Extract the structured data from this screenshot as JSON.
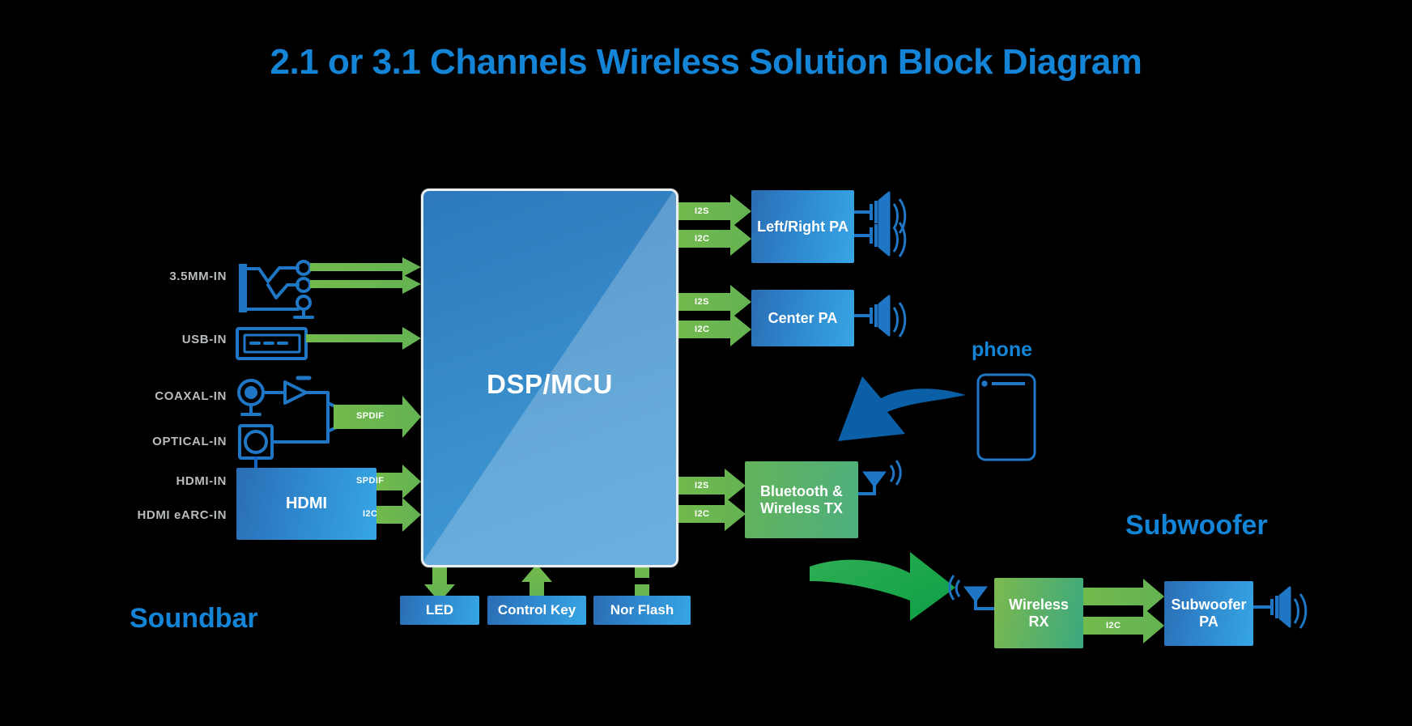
{
  "title": "2.1 or 3.1 Channels Wireless Solution Block Diagram",
  "headings": {
    "soundbar": "Soundbar",
    "subwoofer": "Subwoofer",
    "phone": "phone"
  },
  "inputs": [
    {
      "label": "3.5MM-IN",
      "icon": "jack-3p5mm-icon"
    },
    {
      "label": "USB-IN",
      "icon": "usb-port-icon"
    },
    {
      "label": "COAXAL-IN",
      "icon": "coaxial-jack-icon"
    },
    {
      "label": "OPTICAL-IN",
      "icon": "optical-toslink-icon"
    },
    {
      "label": "HDMI-IN",
      "icon": "hdmi-block-icon"
    },
    {
      "label": "HDMI eARC-IN",
      "icon": "hdmi-block-icon"
    }
  ],
  "blocks": {
    "dsp": "DSP/MCU",
    "hdmi": "HDMI",
    "left_right_pa": "Left/Right PA",
    "center_pa": "Center PA",
    "bluetooth_tx_line1": "Bluetooth &",
    "bluetooth_tx_line2": "Wireless TX",
    "led": "LED",
    "control_key": "Control Key",
    "nor_flash": "Nor Flash",
    "wireless_rx_line1": "Wireless",
    "wireless_rx_line2": "RX",
    "subwoofer_pa_line1": "Subwoofer",
    "subwoofer_pa_line2": "PA"
  },
  "bus_labels": {
    "spdif_coax_optical": "SPDIF",
    "spdif_hdmi": "SPDIF",
    "i2c_hdmi": "I2C",
    "i2s_lr": "I2S",
    "i2c_lr": "I2C",
    "i2s_center": "I2S",
    "i2c_center": "I2C",
    "i2s_bt": "I2S",
    "i2c_bt": "I2C",
    "i2c_sub": "I2C"
  },
  "colors": {
    "background": "#000000",
    "accent_blue": "#1485d6",
    "block_blue": "#2f89cf",
    "block_green": "#57b05f",
    "arrow_green": "#6fb84a",
    "label_grey": "#b9bcbe",
    "connector_blue": "#1f76c4",
    "big_arrow_blue": "#0a5fa6",
    "big_arrow_green": "#12a34a"
  },
  "icons": {
    "speaker": "speaker-icon",
    "antenna": "antenna-icon",
    "wifi_waves": "wifi-waves-icon",
    "phone_outline": "phone-outline-icon",
    "curved_arrow_blue": "curved-arrow-blue-icon",
    "curved_arrow_green": "curved-arrow-green-icon"
  }
}
